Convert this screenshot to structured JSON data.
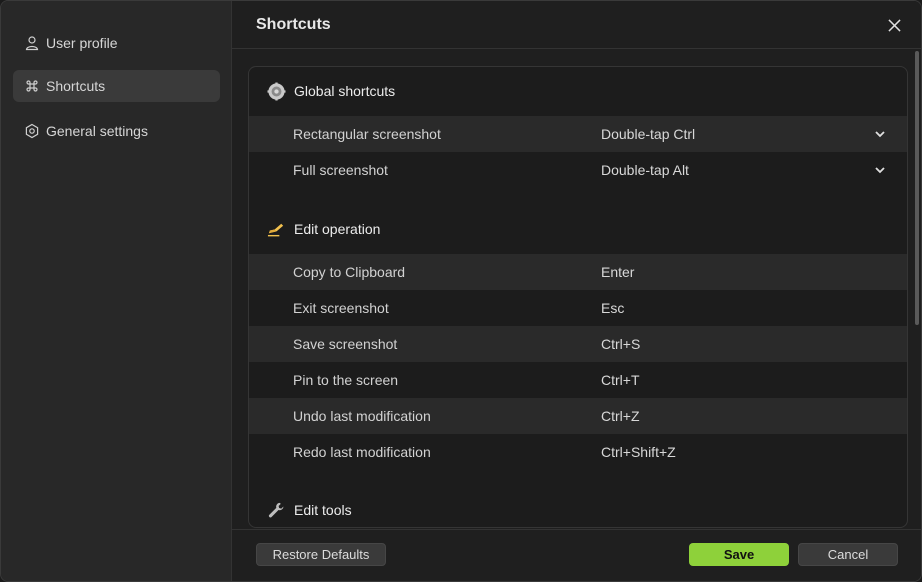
{
  "sidebar": {
    "items": [
      {
        "label": "User profile",
        "icon": "user-icon"
      },
      {
        "label": "Shortcuts",
        "icon": "command-icon",
        "active": true
      },
      {
        "label": "General settings",
        "icon": "hexagon-settings-icon"
      }
    ]
  },
  "header": {
    "title": "Shortcuts",
    "close_icon": "close-icon"
  },
  "sections": [
    {
      "title": "Global shortcuts",
      "icon": "gear-icon",
      "rows": [
        {
          "label": "Rectangular screenshot",
          "value": "Double-tap Ctrl",
          "dropdown": true
        },
        {
          "label": "Full screenshot",
          "value": "Double-tap Alt",
          "dropdown": true
        }
      ]
    },
    {
      "title": "Edit operation",
      "icon": "writing-hand-icon",
      "rows": [
        {
          "label": "Copy to Clipboard",
          "value": "Enter"
        },
        {
          "label": "Exit screenshot",
          "value": "Esc"
        },
        {
          "label": "Save screenshot",
          "value": "Ctrl+S"
        },
        {
          "label": "Pin to the screen",
          "value": "Ctrl+T"
        },
        {
          "label": "Undo last modification",
          "value": "Ctrl+Z"
        },
        {
          "label": "Redo last modification",
          "value": "Ctrl+Shift+Z"
        }
      ]
    },
    {
      "title": "Edit tools",
      "icon": "wrench-icon",
      "rows": []
    }
  ],
  "footer": {
    "restore_label": "Restore Defaults",
    "save_label": "Save",
    "cancel_label": "Cancel"
  },
  "colors": {
    "accent": "#8ed13a",
    "background": "#1f1f1f",
    "sidebar": "#282828"
  }
}
